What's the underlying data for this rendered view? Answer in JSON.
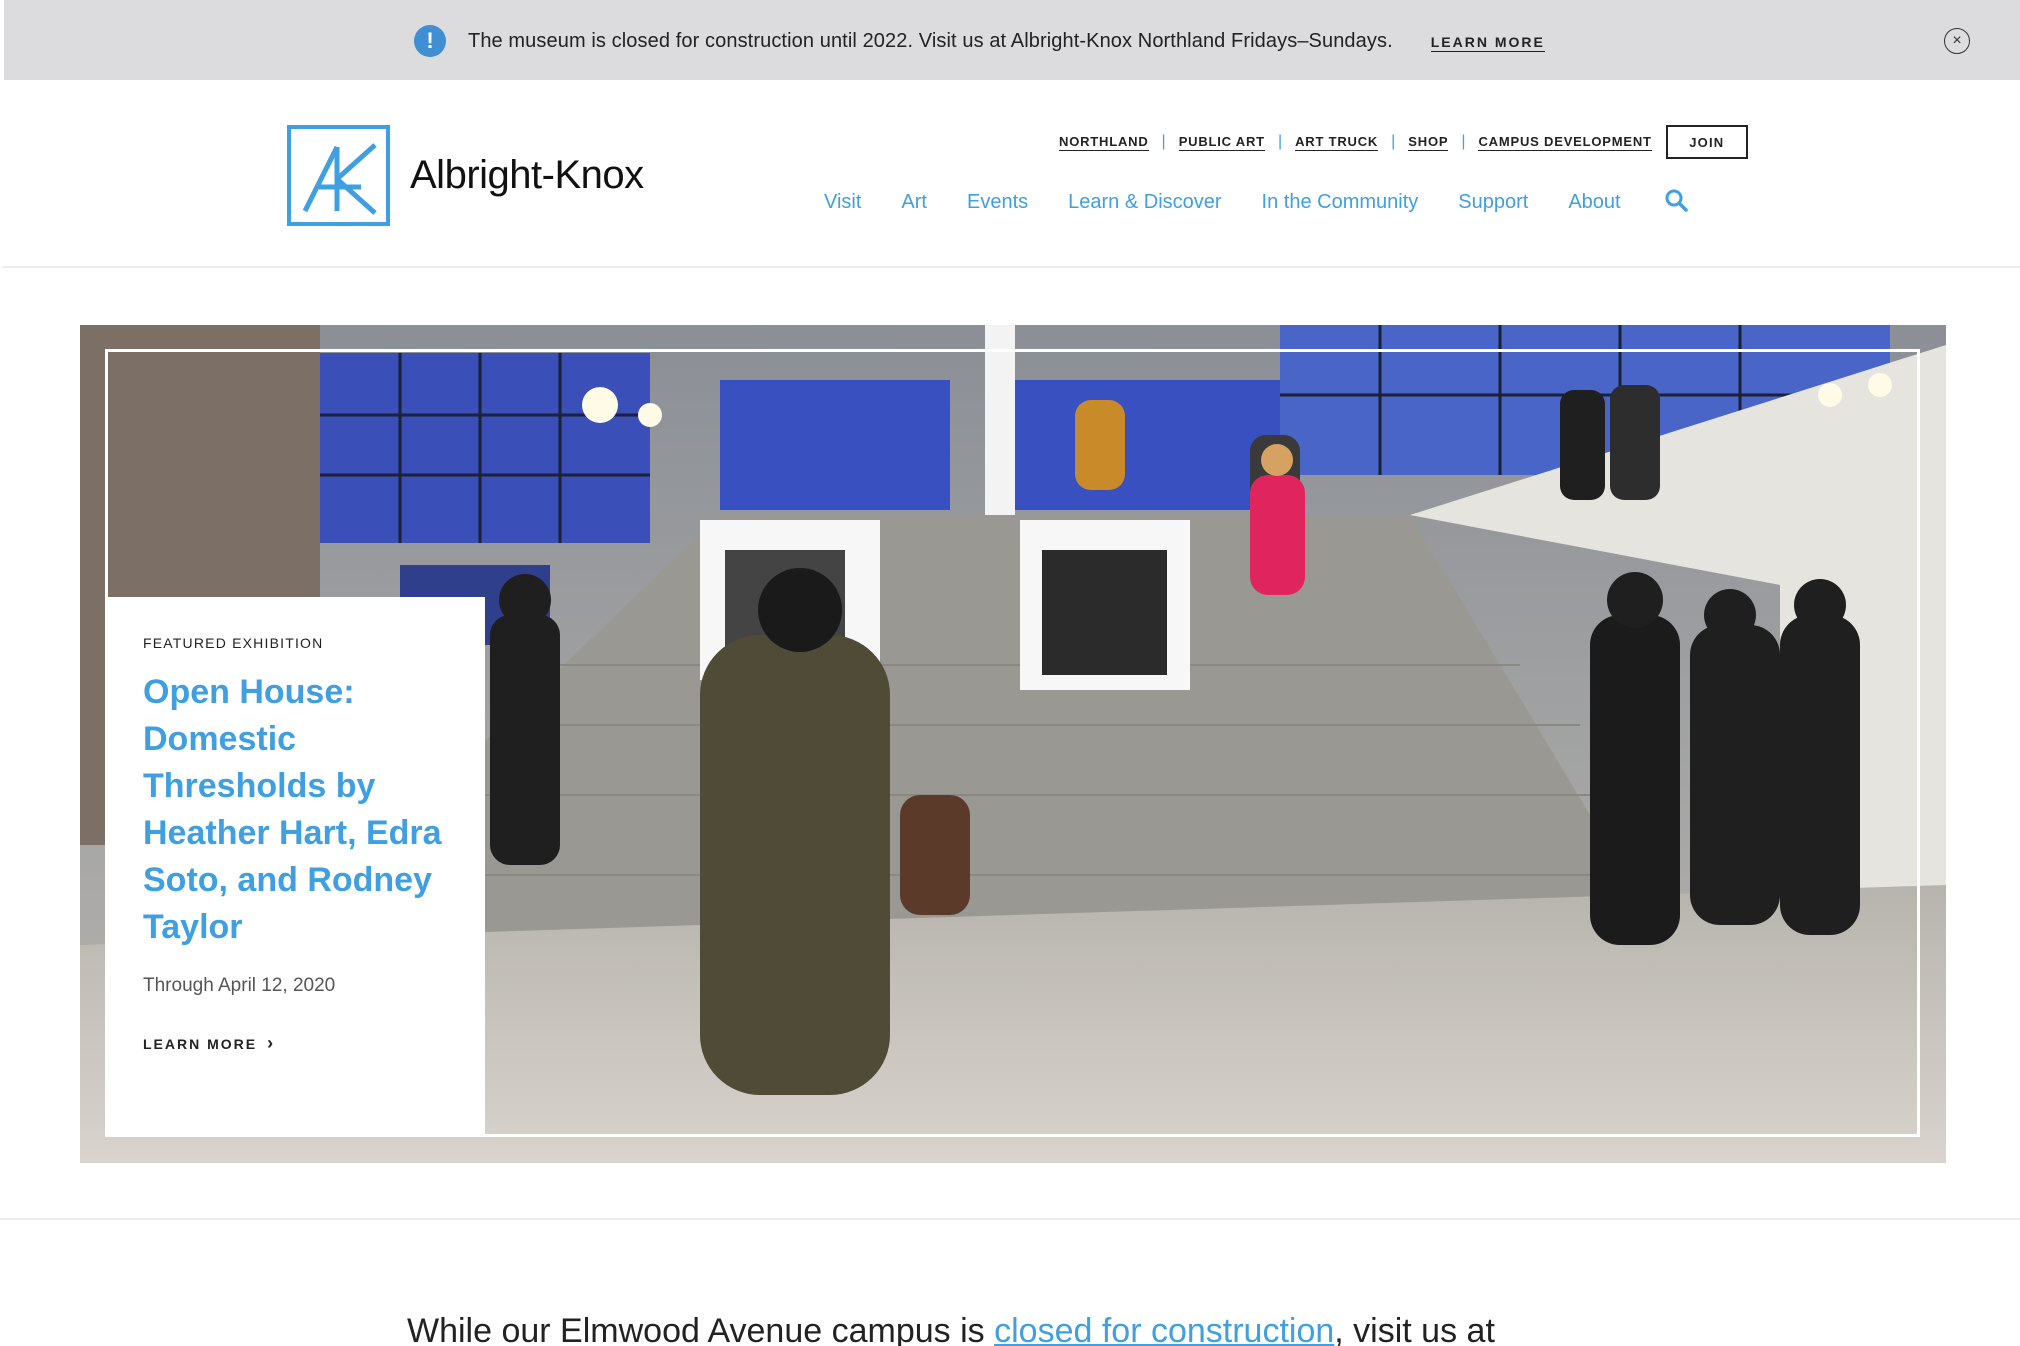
{
  "alert": {
    "icon": "info-icon",
    "icon_glyph": "!",
    "message": "The museum is closed for construction until 2022. Visit us at Albright-Knox Northland Fridays–Sundays.",
    "link_label": "LEARN MORE",
    "close_icon": "close-icon",
    "close_glyph": "×"
  },
  "header": {
    "logo_text": "Albright-Knox",
    "utility_nav": [
      "NORTHLAND",
      "PUBLIC ART",
      "ART TRUCK",
      "SHOP",
      "CAMPUS DEVELOPMENT"
    ],
    "separator": "|",
    "join_label": "JOIN",
    "main_nav": [
      "Visit",
      "Art",
      "Events",
      "Learn & Discover",
      "In the Community",
      "Support",
      "About"
    ],
    "search_icon": "search-icon"
  },
  "hero": {
    "kicker": "FEATURED EXHIBITION",
    "title": "Open House: Domestic Thresholds by Heather Hart, Edra Soto, and Rodney Taylor",
    "date": "Through April 12, 2020",
    "link_label": "LEARN MORE",
    "chevron": "›",
    "image_description_icon": "gallery-photo"
  },
  "intro": {
    "text_before": "While our Elmwood Avenue campus is ",
    "link_text": "closed for construction",
    "text_after": ", visit us at"
  },
  "colors": {
    "accent": "#3f9fe0",
    "alert_bg": "#dcdcde",
    "text": "#222222"
  }
}
